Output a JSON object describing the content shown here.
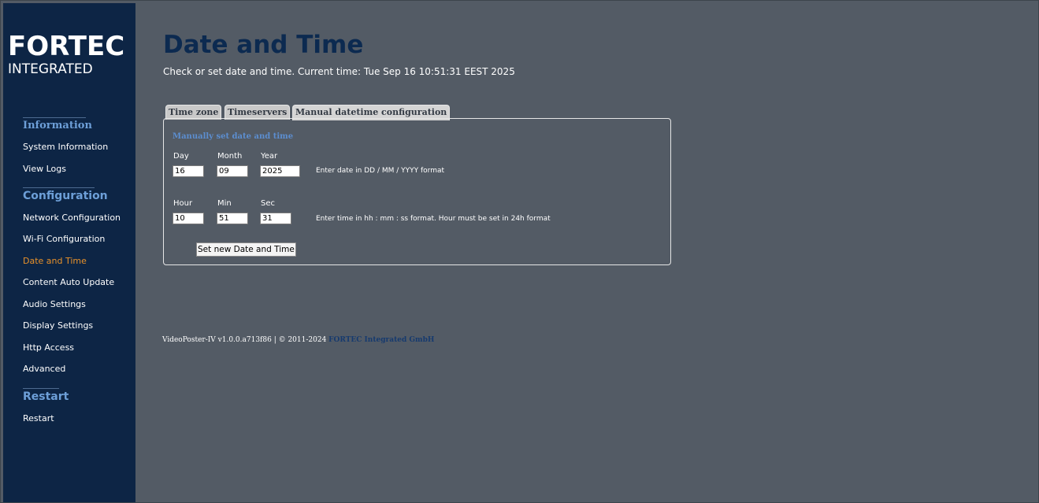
{
  "brand": {
    "logo_main": "FORTEC",
    "logo_sub": "INTEGRATED"
  },
  "sidebar": {
    "sections": [
      {
        "title": "Information",
        "items": [
          {
            "label": "System Information"
          },
          {
            "label": "View Logs"
          }
        ]
      },
      {
        "title": "Configuration",
        "items": [
          {
            "label": "Network Configuration"
          },
          {
            "label": "Wi-Fi Configuration"
          },
          {
            "label": "Date and Time",
            "active": true
          },
          {
            "label": "Content Auto Update"
          },
          {
            "label": "Audio Settings"
          },
          {
            "label": "Display Settings"
          },
          {
            "label": "Http Access"
          },
          {
            "label": "Advanced"
          }
        ]
      },
      {
        "title": "Restart",
        "items": [
          {
            "label": "Restart"
          }
        ]
      }
    ]
  },
  "page": {
    "title": "Date and Time",
    "subtitle": "Check or set date and time. Current time: Tue Sep 16 10:51:31 EEST 2025"
  },
  "tabs": [
    {
      "label": "Time zone"
    },
    {
      "label": "Timeservers"
    },
    {
      "label": "Manual datetime configuration",
      "active": true
    }
  ],
  "form": {
    "heading": "Manually set date and time",
    "date": {
      "day_label": "Day",
      "month_label": "Month",
      "year_label": "Year",
      "day_value": "16",
      "month_value": "09",
      "year_value": "2025",
      "hint": "Enter date in DD / MM / YYYY format"
    },
    "time": {
      "hour_label": "Hour",
      "min_label": "Min",
      "sec_label": "Sec",
      "hour_value": "10",
      "min_value": "51",
      "sec_value": "31",
      "hint": "Enter time in hh : mm : ss format. Hour must be set in 24h format"
    },
    "submit_label": "Set new Date and Time"
  },
  "footer": {
    "text": "VideoPoster-IV v1.0.0.a713f86 | © 2011-2024 ",
    "link": "FORTEC Integrated GmbH"
  },
  "colors": {
    "background": "#535b65",
    "sidebar": "#0d2545",
    "accent_active": "#e8912a",
    "section_title": "#6d9fd8",
    "title": "#0c2a50"
  }
}
